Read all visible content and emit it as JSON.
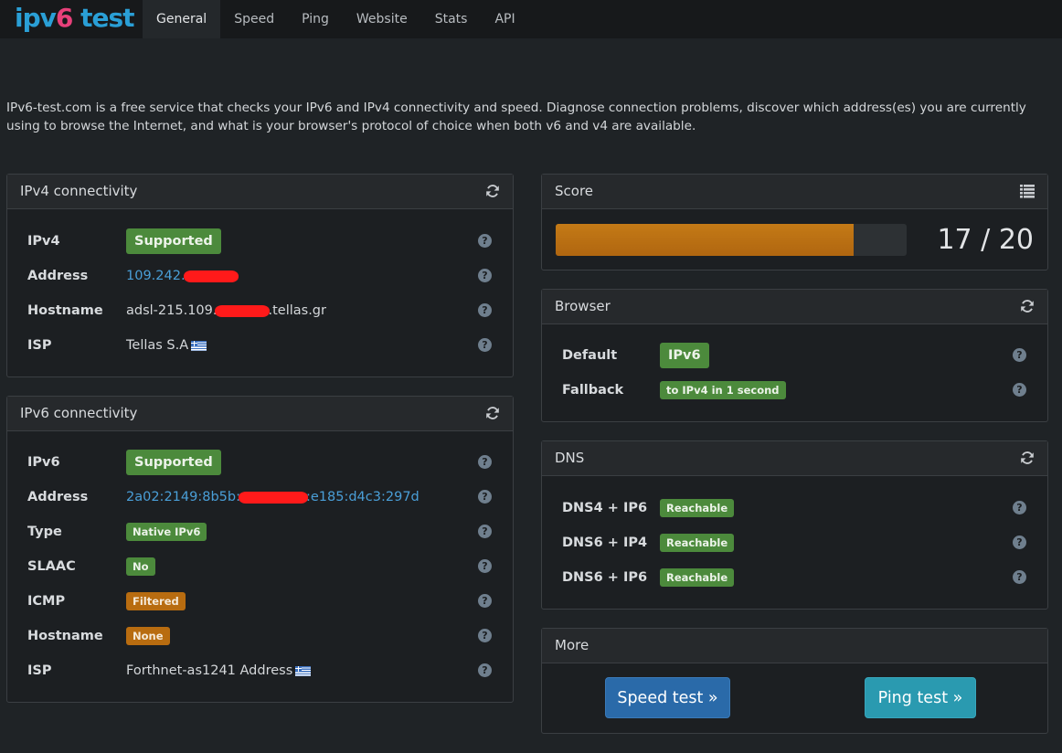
{
  "brand": {
    "part1": "ipv",
    "part2": "6",
    "part3": " test"
  },
  "nav": {
    "items": [
      "General",
      "Speed",
      "Ping",
      "Website",
      "Stats",
      "API"
    ],
    "active": "General"
  },
  "intro": "IPv6-test.com is a free service that checks your IPv6 and IPv4 connectivity and speed. Diagnose connection problems, discover which address(es) you are currently using to browse the Internet, and what is your browser's protocol of choice when both v6 and v4 are available.",
  "ipv4": {
    "title": "IPv4 connectivity",
    "rows": {
      "ipv4": {
        "label": "IPv4",
        "badge": "Supported"
      },
      "address": {
        "label": "Address",
        "value_prefix": "109.242."
      },
      "hostname": {
        "label": "Hostname",
        "value_prefix": "adsl-215.109.",
        "value_suffix": ".tellas.gr"
      },
      "isp": {
        "label": "ISP",
        "value": "Tellas S.A"
      }
    }
  },
  "ipv6": {
    "title": "IPv6 connectivity",
    "rows": {
      "ipv6": {
        "label": "IPv6",
        "badge": "Supported"
      },
      "address": {
        "label": "Address",
        "value_prefix": "2a02:2149:8b5b:",
        "value_suffix": ":e185:d4c3:297d"
      },
      "type": {
        "label": "Type",
        "badge": "Native IPv6"
      },
      "slaac": {
        "label": "SLAAC",
        "badge": "No"
      },
      "icmp": {
        "label": "ICMP",
        "badge": "Filtered"
      },
      "hostname": {
        "label": "Hostname",
        "badge": "None"
      },
      "isp": {
        "label": "ISP",
        "value": "Forthnet-as1241 Address"
      }
    }
  },
  "score": {
    "title": "Score",
    "text": "17 / 20",
    "value": 17,
    "max": 20
  },
  "browser": {
    "title": "Browser",
    "rows": {
      "default": {
        "label": "Default",
        "badge": "IPv6"
      },
      "fallback": {
        "label": "Fallback",
        "badge": "to IPv4 in 1 second"
      }
    }
  },
  "dns": {
    "title": "DNS",
    "rows": {
      "dns4ip6": {
        "label": "DNS4 + IP6",
        "badge": "Reachable"
      },
      "dns6ip4": {
        "label": "DNS6 + IP4",
        "badge": "Reachable"
      },
      "dns6ip6": {
        "label": "DNS6 + IP6",
        "badge": "Reachable"
      }
    }
  },
  "more": {
    "title": "More",
    "speed_test": "Speed test »",
    "ping_test": "Ping test »"
  },
  "help_glyph": "?",
  "colors": {
    "accent_blue": "#2a9fd6",
    "accent_pink": "#e8407a",
    "success": "#4c8a3c",
    "warning": "#b86c10",
    "link": "#4a9fd8",
    "redaction": "#ff1a1a"
  },
  "icons": {
    "refresh": "refresh-icon",
    "list": "list-icon",
    "help": "help-icon",
    "flag": "greece-flag-icon"
  }
}
